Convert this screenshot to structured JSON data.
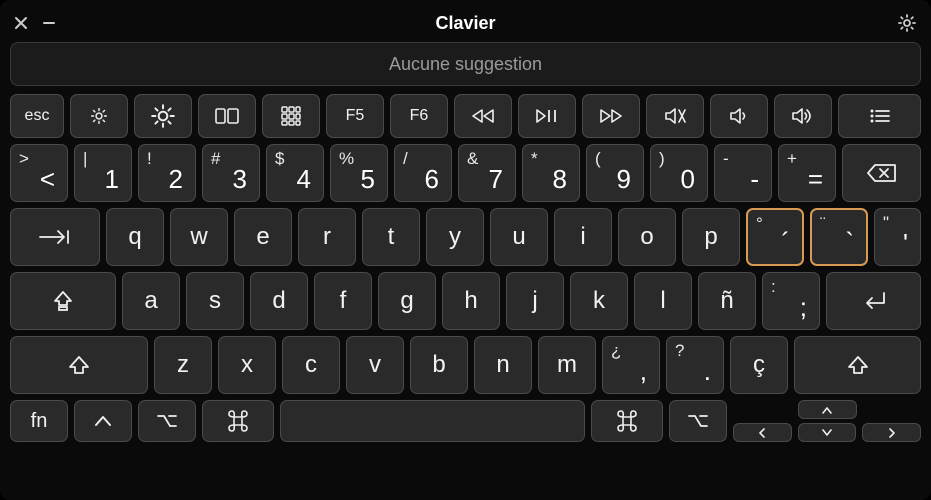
{
  "window": {
    "title": "Clavier"
  },
  "suggestion": {
    "text": "Aucune suggestion"
  },
  "fn_row": {
    "esc": "esc",
    "f5": "F5",
    "f6": "F6"
  },
  "row_num": {
    "k0": {
      "upper": ">",
      "lower": "<"
    },
    "k1": {
      "upper": "|",
      "lower": "1"
    },
    "k2": {
      "upper": "!",
      "lower": "2"
    },
    "k3": {
      "upper": "#",
      "lower": "3"
    },
    "k4": {
      "upper": "$",
      "lower": "4"
    },
    "k5": {
      "upper": "%",
      "lower": "5"
    },
    "k6": {
      "upper": "/",
      "lower": "6"
    },
    "k7": {
      "upper": "&",
      "lower": "7"
    },
    "k8": {
      "upper": "*",
      "lower": "8"
    },
    "k9": {
      "upper": "(",
      "lower": "9"
    },
    "k10": {
      "upper": ")",
      "lower": "0"
    },
    "k11": {
      "upper": "-",
      "lower": "-"
    },
    "k12": {
      "upper": "+",
      "lower": "="
    }
  },
  "row_q": {
    "q": "q",
    "w": "w",
    "e": "e",
    "r": "r",
    "t": "t",
    "y": "y",
    "u": "u",
    "i": "i",
    "o": "o",
    "p": "p",
    "dead1": {
      "upper": "°",
      "lower": "´"
    },
    "dead2": {
      "upper": "¨",
      "lower": "`"
    },
    "quote": {
      "upper": "\"",
      "lower": "'"
    }
  },
  "row_a": {
    "a": "a",
    "s": "s",
    "d": "d",
    "f": "f",
    "g": "g",
    "h": "h",
    "j": "j",
    "k": "k",
    "l": "l",
    "n_tilde": "ñ",
    "semi": {
      "upper": ":",
      "lower": ";"
    }
  },
  "row_z": {
    "z": "z",
    "x": "x",
    "c": "c",
    "v": "v",
    "b": "b",
    "n": "n",
    "m": "m",
    "comma": {
      "upper": "¿",
      "lower": ","
    },
    "period": {
      "upper": "?",
      "lower": "."
    },
    "cedilla": "ç"
  },
  "row_bottom": {
    "fn": "fn"
  }
}
